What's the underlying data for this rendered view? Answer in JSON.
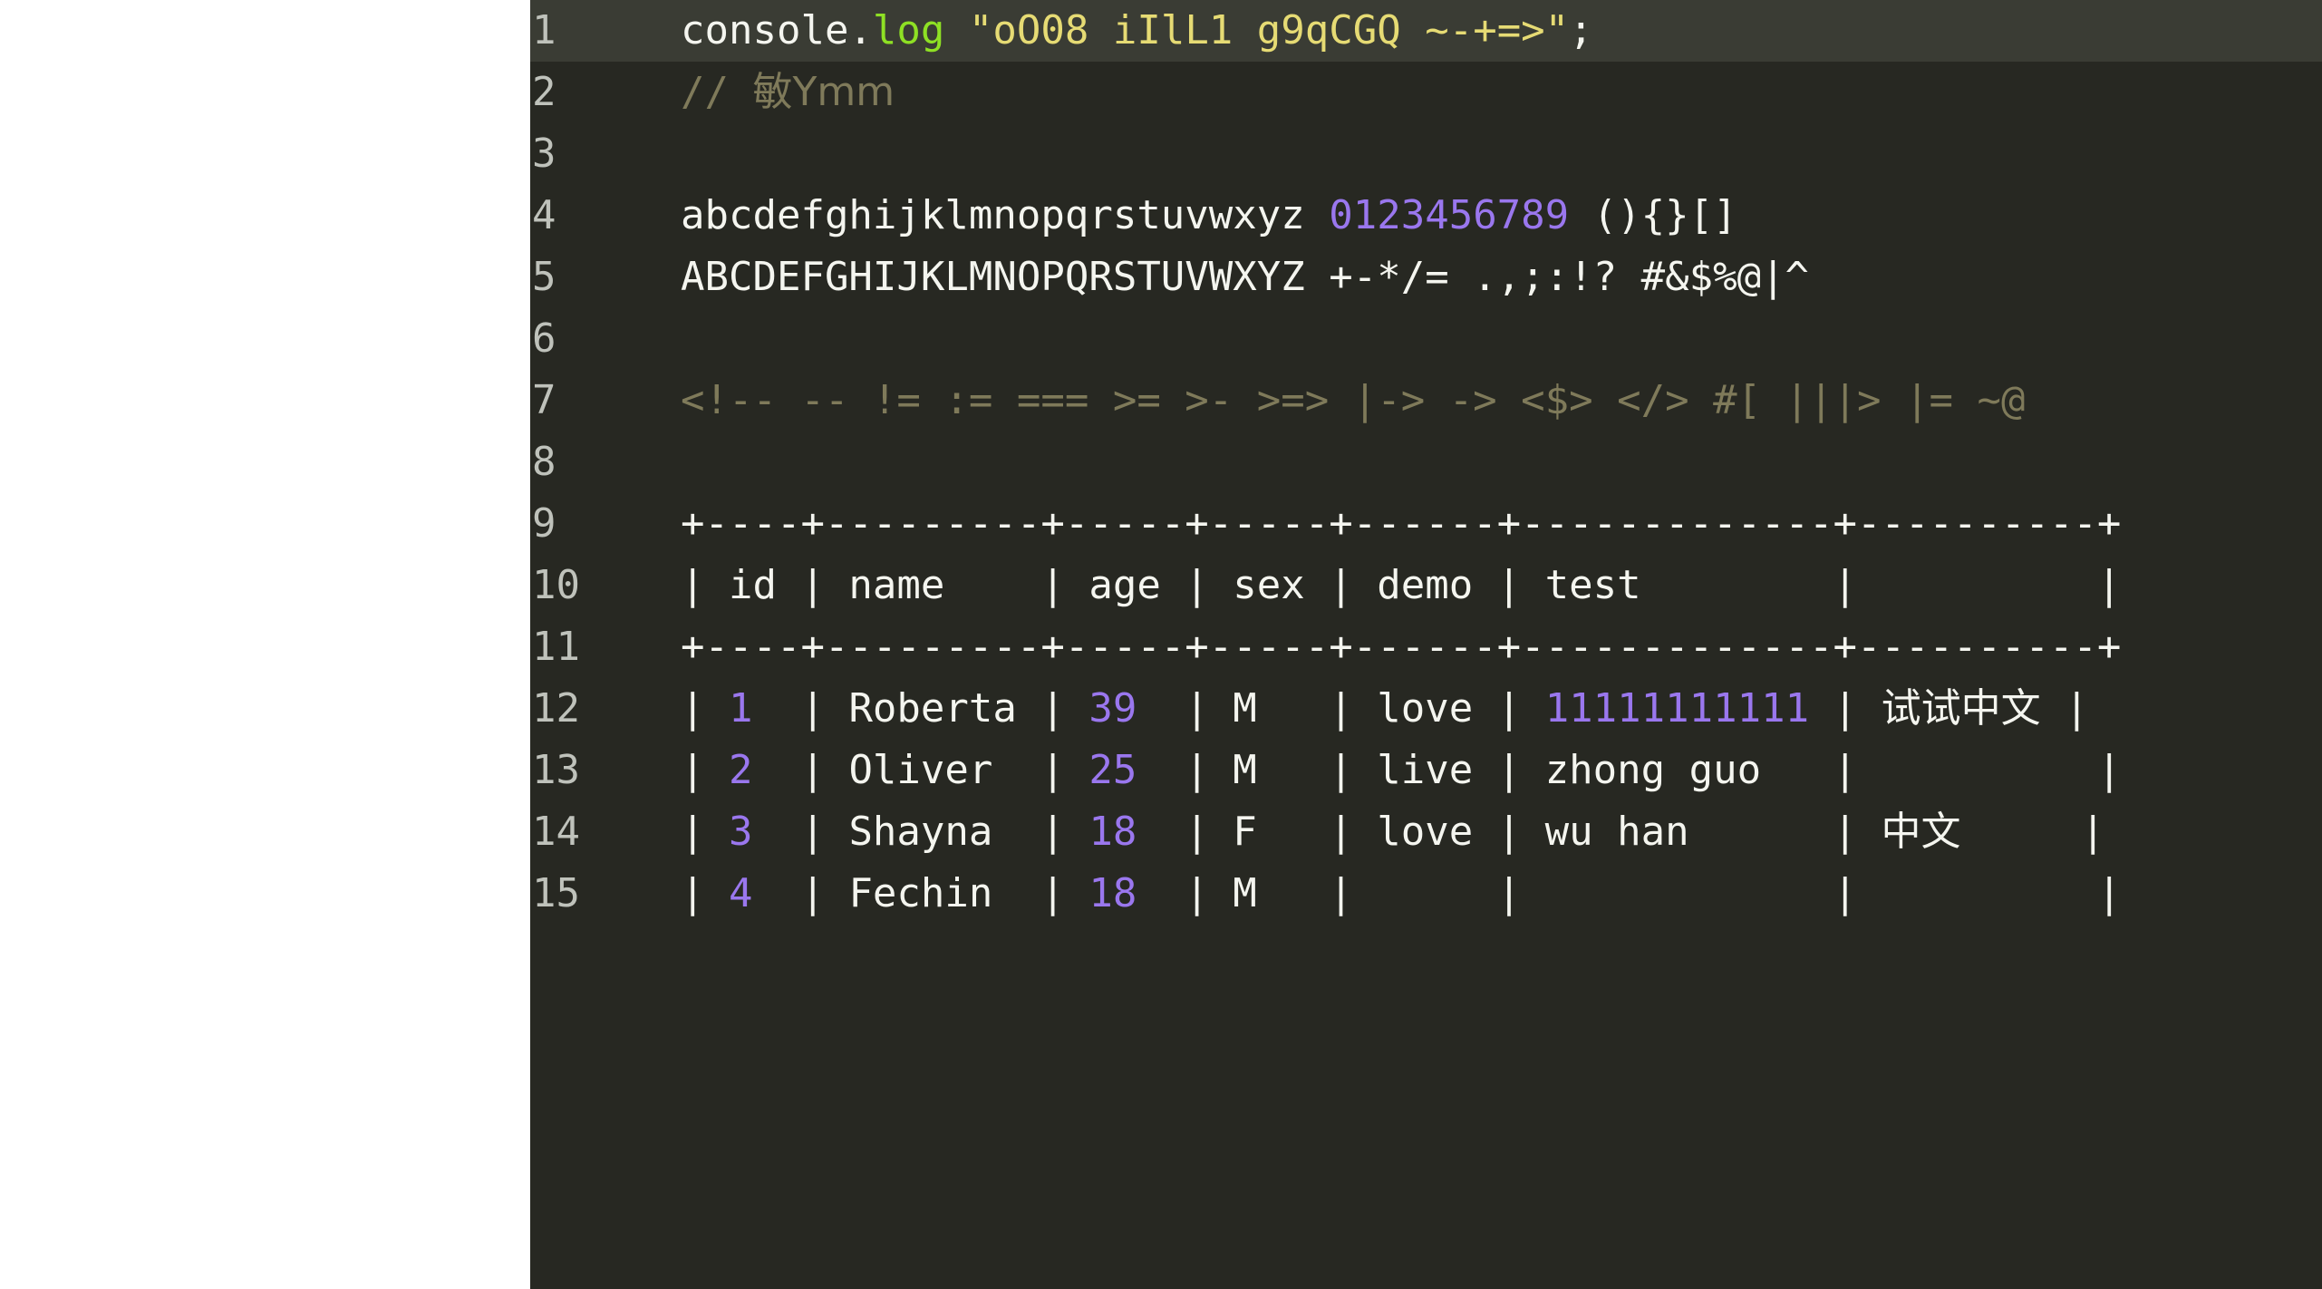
{
  "editor": {
    "theme_name": "monokai-dark",
    "colors": {
      "background": "#272822",
      "active_line_background": "#3a3c34",
      "gutter_text": "#bfc2bb",
      "foreground": "#f4f5ef",
      "function": "#8ee024",
      "string": "#e6db74",
      "comment": "#7f7a5a",
      "number": "#9a77ee"
    },
    "left_margin_background": "#ffffff",
    "lines": [
      {
        "number": "1",
        "active": true,
        "tokens": [
          {
            "text": "console.",
            "type": "plain"
          },
          {
            "text": "log",
            "type": "fn"
          },
          {
            "text": " ",
            "type": "plain"
          },
          {
            "text": "\"oO08 iIlL1 g9qCGQ ~-+=>\"",
            "type": "string"
          },
          {
            "text": ";",
            "type": "plain"
          }
        ]
      },
      {
        "number": "2",
        "active": false,
        "tokens": [
          {
            "text": "// ",
            "type": "comment"
          },
          {
            "text": "敏Ymm",
            "type": "comment",
            "cjk": true
          }
        ]
      },
      {
        "number": "3",
        "active": false,
        "tokens": []
      },
      {
        "number": "4",
        "active": false,
        "tokens": [
          {
            "text": "abcdefghijklmnopqrstuvwxyz ",
            "type": "plain"
          },
          {
            "text": "0123456789",
            "type": "number"
          },
          {
            "text": " (){}[]",
            "type": "plain"
          }
        ]
      },
      {
        "number": "5",
        "active": false,
        "tokens": [
          {
            "text": "ABCDEFGHIJKLMNOPQRSTUVWXYZ +-*/= .,;:!? #&$%@|^",
            "type": "plain"
          }
        ]
      },
      {
        "number": "6",
        "active": false,
        "tokens": []
      },
      {
        "number": "7",
        "active": false,
        "tokens": [
          {
            "text": "<!-- -- != := === >= >- >=> |-> -> <$> </> #[ |||> |= ~@",
            "type": "comment"
          }
        ]
      },
      {
        "number": "8",
        "active": false,
        "tokens": []
      },
      {
        "number": "9",
        "active": false,
        "tokens": [
          {
            "text": "+----+---------+-----+-----+------+-------------+----------+",
            "type": "plain"
          }
        ]
      },
      {
        "number": "10",
        "active": false,
        "tokens": [
          {
            "text": "| id | name    | age | sex | demo | test        |          |",
            "type": "plain"
          }
        ]
      },
      {
        "number": "11",
        "active": false,
        "tokens": [
          {
            "text": "+----+---------+-----+-----+------+-------------+----------+",
            "type": "plain"
          }
        ]
      },
      {
        "number": "12",
        "active": false,
        "tokens": [
          {
            "text": "| ",
            "type": "plain"
          },
          {
            "text": "1",
            "type": "number"
          },
          {
            "text": "  | Roberta | ",
            "type": "plain"
          },
          {
            "text": "39",
            "type": "number"
          },
          {
            "text": "  | M   | love | ",
            "type": "plain"
          },
          {
            "text": "11111111111",
            "type": "number"
          },
          {
            "text": " | ",
            "type": "plain"
          },
          {
            "text": "试试中文",
            "type": "plain",
            "cjk": true
          },
          {
            "text": " |",
            "type": "plain"
          }
        ]
      },
      {
        "number": "13",
        "active": false,
        "tokens": [
          {
            "text": "| ",
            "type": "plain"
          },
          {
            "text": "2",
            "type": "number"
          },
          {
            "text": "  | Oliver  | ",
            "type": "plain"
          },
          {
            "text": "25",
            "type": "number"
          },
          {
            "text": "  | M   | live | zhong guo   |          |",
            "type": "plain"
          }
        ]
      },
      {
        "number": "14",
        "active": false,
        "tokens": [
          {
            "text": "| ",
            "type": "plain"
          },
          {
            "text": "3",
            "type": "number"
          },
          {
            "text": "  | Shayna  | ",
            "type": "plain"
          },
          {
            "text": "18",
            "type": "number"
          },
          {
            "text": "  | F   | love | wu han      | ",
            "type": "plain"
          },
          {
            "text": "中文",
            "type": "plain",
            "cjk": true
          },
          {
            "text": "     |",
            "type": "plain"
          }
        ]
      },
      {
        "number": "15",
        "active": false,
        "tokens": [
          {
            "text": "| ",
            "type": "plain"
          },
          {
            "text": "4",
            "type": "number"
          },
          {
            "text": "  | Fechin  | ",
            "type": "plain"
          },
          {
            "text": "18",
            "type": "number"
          },
          {
            "text": "  | M   |      |             |          |",
            "type": "plain"
          }
        ]
      }
    ]
  }
}
